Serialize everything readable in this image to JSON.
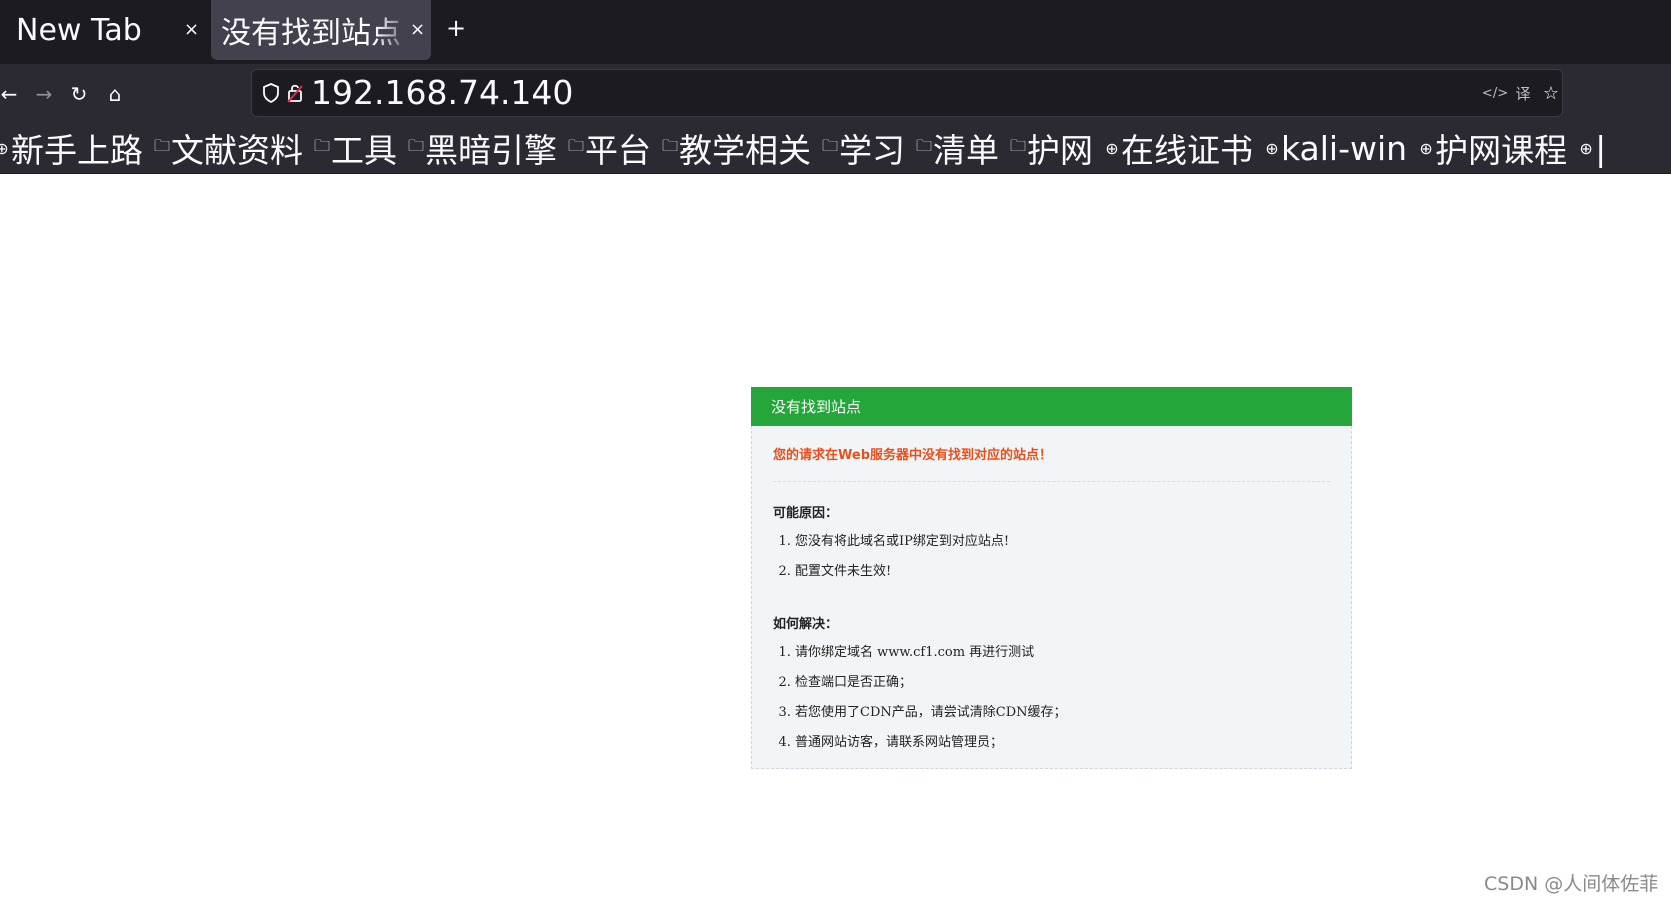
{
  "tabs": [
    {
      "title": "New Tab",
      "close_glyph": "×"
    },
    {
      "title": "没有找到站点",
      "close_glyph": "×"
    }
  ],
  "new_tab_glyph": "+",
  "nav": {
    "back_icon": "←",
    "forward_icon": "→",
    "reload_icon": "↻",
    "home_icon": "⌂"
  },
  "urlbar": {
    "url": "192.168.74.140",
    "reader_icon": "</>",
    "translate_icon": "译",
    "star_icon": "☆"
  },
  "bookmarks": [
    {
      "label": "新手上路",
      "icon": "globe-icon",
      "glyph": "⊕"
    },
    {
      "label": "文献资料",
      "icon": "folder-icon",
      "glyph": "🗀"
    },
    {
      "label": "工具",
      "icon": "folder-icon",
      "glyph": "🗀"
    },
    {
      "label": "黑暗引擎",
      "icon": "folder-icon",
      "glyph": "🗀"
    },
    {
      "label": "平台",
      "icon": "folder-icon",
      "glyph": "🗀"
    },
    {
      "label": "教学相关",
      "icon": "folder-icon",
      "glyph": "🗀"
    },
    {
      "label": "学习",
      "icon": "folder-icon",
      "glyph": "🗀"
    },
    {
      "label": "清单",
      "icon": "folder-icon",
      "glyph": "🗀"
    },
    {
      "label": "护网",
      "icon": "folder-icon",
      "glyph": "🗀"
    },
    {
      "label": "在线证书",
      "icon": "globe-icon",
      "glyph": "⊕"
    },
    {
      "label": "kali-win",
      "icon": "globe-icon",
      "glyph": "⊕"
    },
    {
      "label": "护网课程",
      "icon": "globe-icon",
      "glyph": "⊕"
    },
    {
      "label": "|",
      "icon": "globe-icon",
      "glyph": "⊕"
    }
  ],
  "error": {
    "header": "没有找到站点",
    "message": "您的请求在Web服务器中没有找到对应的站点！",
    "reasons_title": "可能原因：",
    "reasons": [
      "您没有将此域名或IP绑定到对应站点!",
      "配置文件未生效!"
    ],
    "solutions_title": "如何解决：",
    "solutions": [
      "请你绑定域名 www.cf1.com 再进行测试",
      "检查端口是否正确；",
      "若您使用了CDN产品，请尝试清除CDN缓存；",
      "普通网站访客，请联系网站管理员；"
    ]
  },
  "watermark": "CSDN @人间体佐菲",
  "colors": {
    "chrome_dark": "#1c1b22",
    "chrome": "#2b2a33",
    "header_green": "#24a63a",
    "error_orange": "#e4511d"
  }
}
